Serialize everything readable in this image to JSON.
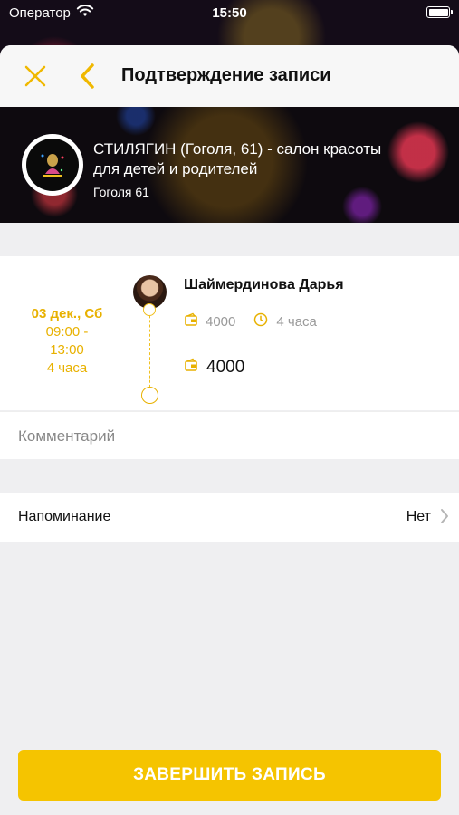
{
  "status_bar": {
    "carrier": "Оператор",
    "time": "15:50"
  },
  "nav": {
    "title": "Подтверждение записи",
    "close_icon": "close-x-icon",
    "back_icon": "chevron-left-icon"
  },
  "salon": {
    "name": "СТИЛЯГИН (Гоголя, 61) - салон красоты для детей и родителей",
    "address": "Гоголя 61"
  },
  "booking": {
    "date": "03 дек., Сб",
    "time_range_start": "09:00 -",
    "time_range_end": "13:00",
    "duration": "4 часа",
    "master_name": "Шаймердинова Дарья",
    "service_price": "4000",
    "service_duration": "4 часа",
    "total_price": "4000"
  },
  "comment": {
    "placeholder": "Комментарий",
    "value": ""
  },
  "reminder": {
    "label": "Напоминание",
    "value": "Нет"
  },
  "finish_button": {
    "label": "ЗАВЕРШИТЬ ЗАПИСЬ"
  },
  "colors": {
    "accent": "#f5c400",
    "accent_text": "#e8b100",
    "background": "#efeff1"
  }
}
